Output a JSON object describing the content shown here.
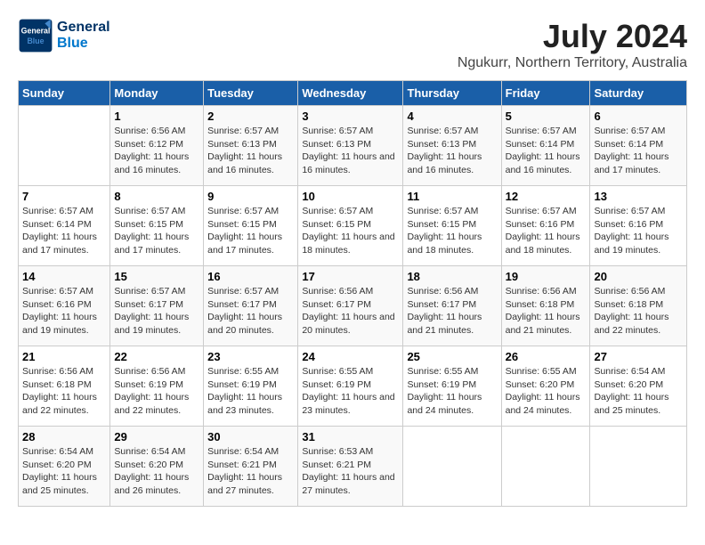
{
  "header": {
    "logo_line1": "General",
    "logo_line2": "Blue",
    "month_year": "July 2024",
    "location": "Ngukurr, Northern Territory, Australia"
  },
  "days_of_week": [
    "Sunday",
    "Monday",
    "Tuesday",
    "Wednesday",
    "Thursday",
    "Friday",
    "Saturday"
  ],
  "weeks": [
    [
      {
        "day": "",
        "info": ""
      },
      {
        "day": "1",
        "info": "Sunrise: 6:56 AM\nSunset: 6:12 PM\nDaylight: 11 hours and 16 minutes."
      },
      {
        "day": "2",
        "info": "Sunrise: 6:57 AM\nSunset: 6:13 PM\nDaylight: 11 hours and 16 minutes."
      },
      {
        "day": "3",
        "info": "Sunrise: 6:57 AM\nSunset: 6:13 PM\nDaylight: 11 hours and 16 minutes."
      },
      {
        "day": "4",
        "info": "Sunrise: 6:57 AM\nSunset: 6:13 PM\nDaylight: 11 hours and 16 minutes."
      },
      {
        "day": "5",
        "info": "Sunrise: 6:57 AM\nSunset: 6:14 PM\nDaylight: 11 hours and 16 minutes."
      },
      {
        "day": "6",
        "info": "Sunrise: 6:57 AM\nSunset: 6:14 PM\nDaylight: 11 hours and 17 minutes."
      }
    ],
    [
      {
        "day": "7",
        "info": "Sunrise: 6:57 AM\nSunset: 6:14 PM\nDaylight: 11 hours and 17 minutes."
      },
      {
        "day": "8",
        "info": "Sunrise: 6:57 AM\nSunset: 6:15 PM\nDaylight: 11 hours and 17 minutes."
      },
      {
        "day": "9",
        "info": "Sunrise: 6:57 AM\nSunset: 6:15 PM\nDaylight: 11 hours and 17 minutes."
      },
      {
        "day": "10",
        "info": "Sunrise: 6:57 AM\nSunset: 6:15 PM\nDaylight: 11 hours and 18 minutes."
      },
      {
        "day": "11",
        "info": "Sunrise: 6:57 AM\nSunset: 6:15 PM\nDaylight: 11 hours and 18 minutes."
      },
      {
        "day": "12",
        "info": "Sunrise: 6:57 AM\nSunset: 6:16 PM\nDaylight: 11 hours and 18 minutes."
      },
      {
        "day": "13",
        "info": "Sunrise: 6:57 AM\nSunset: 6:16 PM\nDaylight: 11 hours and 19 minutes."
      }
    ],
    [
      {
        "day": "14",
        "info": "Sunrise: 6:57 AM\nSunset: 6:16 PM\nDaylight: 11 hours and 19 minutes."
      },
      {
        "day": "15",
        "info": "Sunrise: 6:57 AM\nSunset: 6:17 PM\nDaylight: 11 hours and 19 minutes."
      },
      {
        "day": "16",
        "info": "Sunrise: 6:57 AM\nSunset: 6:17 PM\nDaylight: 11 hours and 20 minutes."
      },
      {
        "day": "17",
        "info": "Sunrise: 6:56 AM\nSunset: 6:17 PM\nDaylight: 11 hours and 20 minutes."
      },
      {
        "day": "18",
        "info": "Sunrise: 6:56 AM\nSunset: 6:17 PM\nDaylight: 11 hours and 21 minutes."
      },
      {
        "day": "19",
        "info": "Sunrise: 6:56 AM\nSunset: 6:18 PM\nDaylight: 11 hours and 21 minutes."
      },
      {
        "day": "20",
        "info": "Sunrise: 6:56 AM\nSunset: 6:18 PM\nDaylight: 11 hours and 22 minutes."
      }
    ],
    [
      {
        "day": "21",
        "info": "Sunrise: 6:56 AM\nSunset: 6:18 PM\nDaylight: 11 hours and 22 minutes."
      },
      {
        "day": "22",
        "info": "Sunrise: 6:56 AM\nSunset: 6:19 PM\nDaylight: 11 hours and 22 minutes."
      },
      {
        "day": "23",
        "info": "Sunrise: 6:55 AM\nSunset: 6:19 PM\nDaylight: 11 hours and 23 minutes."
      },
      {
        "day": "24",
        "info": "Sunrise: 6:55 AM\nSunset: 6:19 PM\nDaylight: 11 hours and 23 minutes."
      },
      {
        "day": "25",
        "info": "Sunrise: 6:55 AM\nSunset: 6:19 PM\nDaylight: 11 hours and 24 minutes."
      },
      {
        "day": "26",
        "info": "Sunrise: 6:55 AM\nSunset: 6:20 PM\nDaylight: 11 hours and 24 minutes."
      },
      {
        "day": "27",
        "info": "Sunrise: 6:54 AM\nSunset: 6:20 PM\nDaylight: 11 hours and 25 minutes."
      }
    ],
    [
      {
        "day": "28",
        "info": "Sunrise: 6:54 AM\nSunset: 6:20 PM\nDaylight: 11 hours and 25 minutes."
      },
      {
        "day": "29",
        "info": "Sunrise: 6:54 AM\nSunset: 6:20 PM\nDaylight: 11 hours and 26 minutes."
      },
      {
        "day": "30",
        "info": "Sunrise: 6:54 AM\nSunset: 6:21 PM\nDaylight: 11 hours and 27 minutes."
      },
      {
        "day": "31",
        "info": "Sunrise: 6:53 AM\nSunset: 6:21 PM\nDaylight: 11 hours and 27 minutes."
      },
      {
        "day": "",
        "info": ""
      },
      {
        "day": "",
        "info": ""
      },
      {
        "day": "",
        "info": ""
      }
    ]
  ]
}
